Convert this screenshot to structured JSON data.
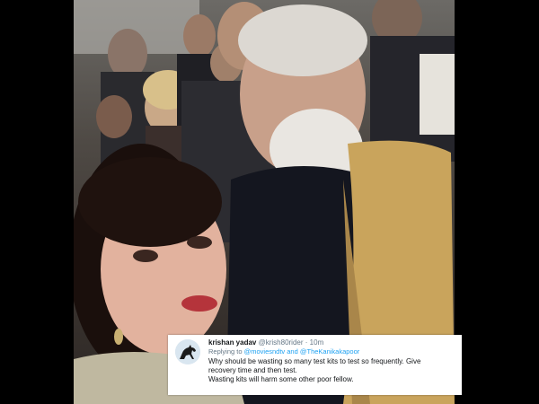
{
  "tweet": {
    "display_name": "krishan yadav",
    "handle": "@krish80rider",
    "separator": "·",
    "time": "10m",
    "reply_prefix": "Replying to",
    "reply_mention_1": "@moviesndtv",
    "reply_and": "and",
    "reply_mention_2": "@TheKanikakapoor",
    "text_line_1": "Why should be wasting so many test kits to test so frequently. Give",
    "text_line_2": "recovery time and then test.",
    "text_line_3": "Wasting kits will harm some other poor fellow."
  },
  "icons": {
    "avatar": "horse-avatar-icon"
  },
  "colors": {
    "background": "#000000",
    "link": "#1da1f2",
    "secondary_text": "#657786",
    "primary_text": "#14171a"
  }
}
